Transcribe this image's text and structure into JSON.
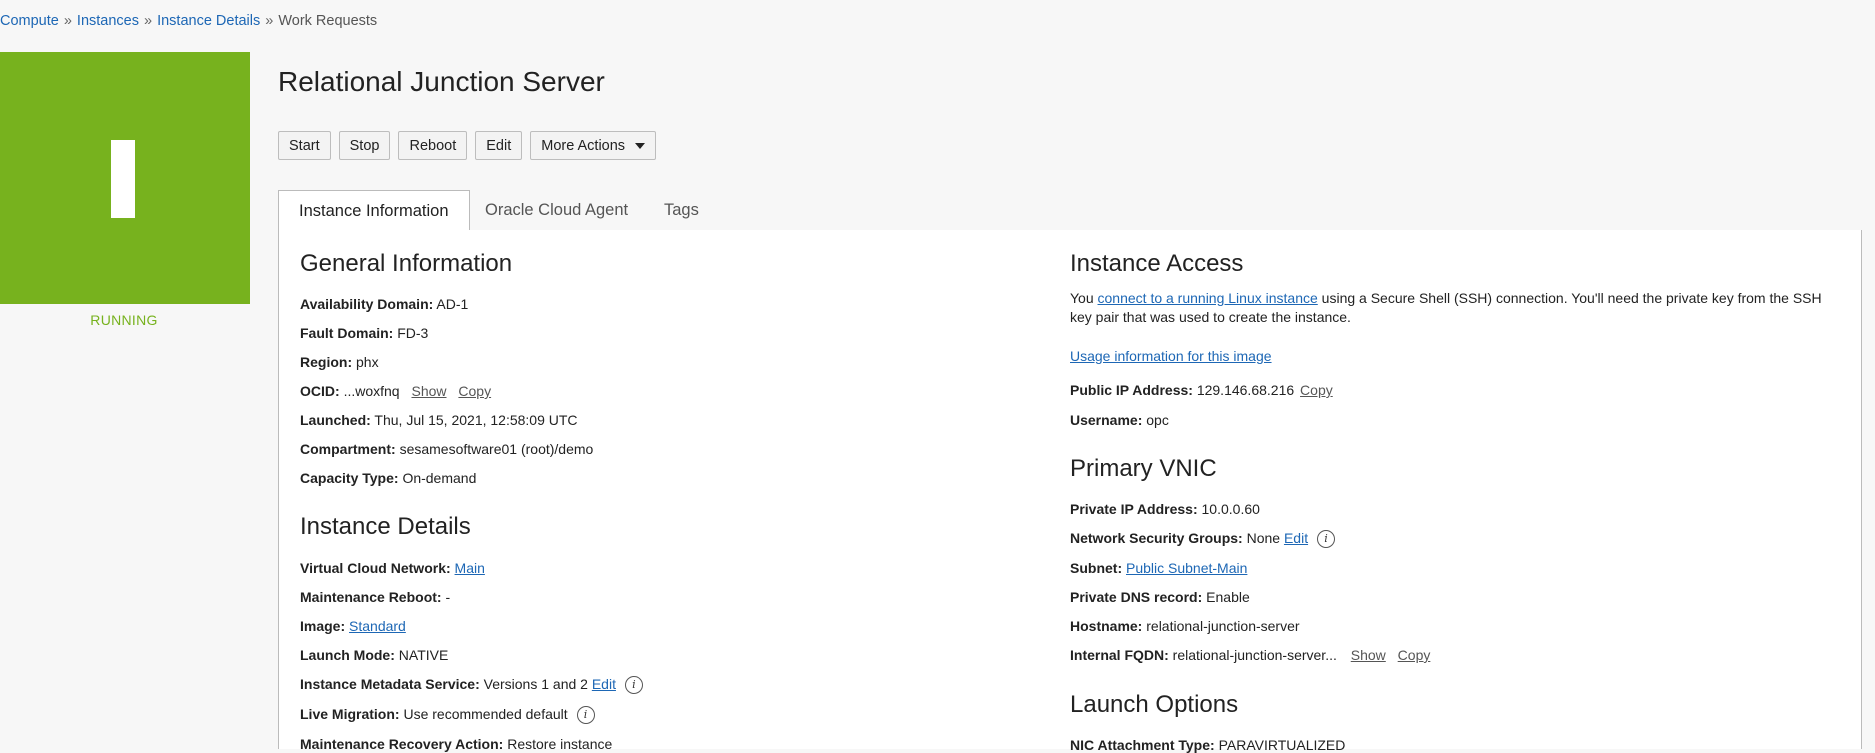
{
  "breadcrumb": {
    "items": [
      "Compute",
      "Instances",
      "Instance Details"
    ],
    "separator": "»",
    "current": "Work Requests"
  },
  "instance": {
    "title": "Relational Junction Server",
    "status": "RUNNING",
    "status_color": "#77b21e"
  },
  "actions": {
    "start": "Start",
    "stop": "Stop",
    "reboot": "Reboot",
    "edit": "Edit",
    "more": "More Actions"
  },
  "tabs": {
    "instance_info": "Instance Information",
    "cloud_agent": "Oracle Cloud Agent",
    "tags": "Tags"
  },
  "general": {
    "title": "General Information",
    "availability_domain": {
      "label": "Availability Domain:",
      "value": "AD-1"
    },
    "fault_domain": {
      "label": "Fault Domain:",
      "value": "FD-3"
    },
    "region": {
      "label": "Region:",
      "value": "phx"
    },
    "ocid": {
      "label": "OCID:",
      "value": "...woxfnq",
      "show": "Show",
      "copy": "Copy"
    },
    "launched": {
      "label": "Launched:",
      "value": "Thu, Jul 15, 2021, 12:58:09 UTC"
    },
    "compartment": {
      "label": "Compartment:",
      "value": "sesamesoftware01 (root)/demo"
    },
    "capacity_type": {
      "label": "Capacity Type:",
      "value": "On-demand"
    }
  },
  "details": {
    "title": "Instance Details",
    "vcn": {
      "label": "Virtual Cloud Network:",
      "value": "Main"
    },
    "maintenance_reboot": {
      "label": "Maintenance Reboot:",
      "value": "-"
    },
    "image": {
      "label": "Image:",
      "value": "Standard"
    },
    "launch_mode": {
      "label": "Launch Mode:",
      "value": "NATIVE"
    },
    "metadata_service": {
      "label": "Instance Metadata Service:",
      "value": "Versions 1 and 2",
      "edit": "Edit"
    },
    "live_migration": {
      "label": "Live Migration:",
      "value": "Use recommended default"
    },
    "recovery_action": {
      "label": "Maintenance Recovery Action:",
      "value": "Restore instance"
    }
  },
  "access": {
    "title": "Instance Access",
    "intro_before": "You ",
    "intro_link": "connect to a running Linux instance",
    "intro_after": " using a Secure Shell (SSH) connection. You'll need the private key from the SSH key pair that was used to create the instance.",
    "usage_link": "Usage information for this image",
    "public_ip": {
      "label": "Public IP Address:",
      "value": "129.146.68.216",
      "copy": "Copy"
    },
    "username": {
      "label": "Username:",
      "value": "opc"
    }
  },
  "vnic": {
    "title": "Primary VNIC",
    "private_ip": {
      "label": "Private IP Address:",
      "value": "10.0.0.60"
    },
    "nsg": {
      "label": "Network Security Groups:",
      "value": "None",
      "edit": "Edit"
    },
    "subnet": {
      "label": "Subnet:",
      "value": "Public Subnet-Main"
    },
    "dns_record": {
      "label": "Private DNS record:",
      "value": "Enable"
    },
    "hostname": {
      "label": "Hostname:",
      "value": "relational-junction-server"
    },
    "fqdn": {
      "label": "Internal FQDN:",
      "value": "relational-junction-server...",
      "show": "Show",
      "copy": "Copy"
    }
  },
  "launch": {
    "title": "Launch Options",
    "nic_type": {
      "label": "NIC Attachment Type:",
      "value": "PARAVIRTUALIZED"
    }
  }
}
